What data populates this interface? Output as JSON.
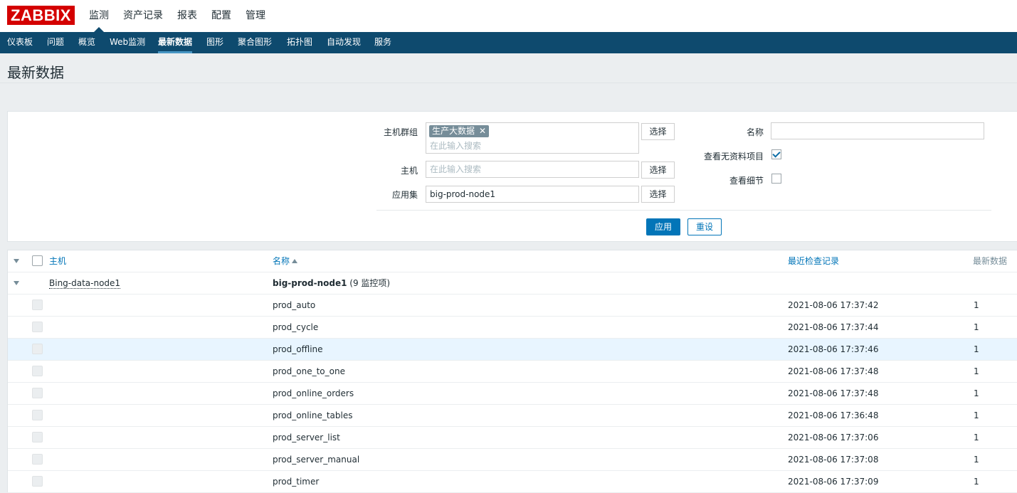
{
  "header": {
    "logo": "ZABBIX",
    "main_nav": [
      "监测",
      "资产记录",
      "报表",
      "配置",
      "管理"
    ],
    "active_main": 0,
    "sub_nav": [
      "仪表板",
      "问题",
      "概览",
      "Web监测",
      "最新数据",
      "图形",
      "聚合图形",
      "拓扑图",
      "自动发现",
      "服务"
    ],
    "active_sub": 4
  },
  "page": {
    "title": "最新数据"
  },
  "filter": {
    "host_group_label": "主机群组",
    "host_group_tag": "生产大数据",
    "host_group_placeholder": "在此输入搜索",
    "host_label": "主机",
    "host_placeholder": "在此输入搜索",
    "app_label": "应用集",
    "app_value": "big-prod-node1",
    "select_label": "选择",
    "name_label": "名称",
    "name_value": "",
    "show_no_data_label": "查看无资料项目",
    "show_no_data_checked": true,
    "show_details_label": "查看细节",
    "show_details_checked": false,
    "apply_label": "应用",
    "reset_label": "重设"
  },
  "table": {
    "columns": {
      "host": "主机",
      "name": "名称",
      "last_check": "最近检查记录",
      "last_value": "最新数据"
    },
    "group": {
      "host": "Bing-data-node1",
      "app": "big-prod-node1",
      "count": "(9 监控项)"
    },
    "rows": [
      {
        "name": "prod_auto",
        "last_check": "2021-08-06 17:37:42",
        "last_value": "1"
      },
      {
        "name": "prod_cycle",
        "last_check": "2021-08-06 17:37:44",
        "last_value": "1"
      },
      {
        "name": "prod_offline",
        "last_check": "2021-08-06 17:37:46",
        "last_value": "1"
      },
      {
        "name": "prod_one_to_one",
        "last_check": "2021-08-06 17:37:48",
        "last_value": "1"
      },
      {
        "name": "prod_online_orders",
        "last_check": "2021-08-06 17:37:48",
        "last_value": "1"
      },
      {
        "name": "prod_online_tables",
        "last_check": "2021-08-06 17:36:48",
        "last_value": "1"
      },
      {
        "name": "prod_server_list",
        "last_check": "2021-08-06 17:37:06",
        "last_value": "1"
      },
      {
        "name": "prod_server_manual",
        "last_check": "2021-08-06 17:37:08",
        "last_value": "1"
      },
      {
        "name": "prod_timer",
        "last_check": "2021-08-06 17:37:09",
        "last_value": "1"
      }
    ],
    "hover_row": 2
  },
  "colors": {
    "brand": "#d40000",
    "nav": "#0e4a6e",
    "accent": "#0275b8"
  }
}
